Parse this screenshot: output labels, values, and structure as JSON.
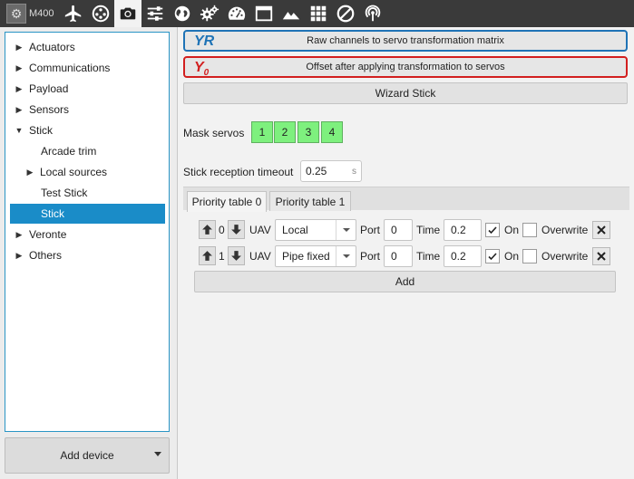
{
  "toolbar": {
    "device_label": "M400",
    "icons": [
      "airplane-icon",
      "joystick-icon",
      "camera-icon",
      "sliders-icon",
      "globe-icon",
      "gears-icon",
      "dashboard-icon",
      "window-icon",
      "mountains-icon",
      "grid-icon",
      "no-sign-icon",
      "antenna-icon"
    ],
    "active_icon": "camera-icon"
  },
  "sidebar": {
    "items": [
      {
        "label": "Actuators",
        "arrow": "▶"
      },
      {
        "label": "Communications",
        "arrow": "▶"
      },
      {
        "label": "Payload",
        "arrow": "▶"
      },
      {
        "label": "Sensors",
        "arrow": "▶"
      },
      {
        "label": "Stick",
        "arrow": "▼"
      },
      {
        "label": "Arcade trim",
        "arrow": ""
      },
      {
        "label": "Local sources",
        "arrow": "▶"
      },
      {
        "label": "Test Stick",
        "arrow": ""
      },
      {
        "label": "Stick",
        "arrow": "",
        "selected": true
      },
      {
        "label": "Veronte",
        "arrow": "▶"
      },
      {
        "label": "Others",
        "arrow": "▶"
      }
    ],
    "add_device_label": "Add device"
  },
  "main": {
    "yr_symbol": "YR",
    "yr_label": "Raw channels to servo transformation matrix",
    "y0_symbol": "Y",
    "y0_sub": "0",
    "y0_label": "Offset after applying transformation to servos",
    "wizard_label": "Wizard Stick",
    "mask_label": "Mask servos",
    "mask_servos": [
      "1",
      "2",
      "3",
      "4"
    ],
    "timeout_label": "Stick reception timeout",
    "timeout_value": "0.25",
    "timeout_unit": "s",
    "tabs": [
      "Priority table 0",
      "Priority table 1"
    ],
    "rows": [
      {
        "index": "0",
        "uav_label": "UAV",
        "uav": "Local",
        "port_label": "Port",
        "port": "0",
        "time_label": "Time",
        "time": "0.2",
        "on_label": "On",
        "on": true,
        "overwrite_label": "Overwrite",
        "overwrite": false
      },
      {
        "index": "1",
        "uav_label": "UAV",
        "uav": "Pipe fixed",
        "port_label": "Port",
        "port": "0",
        "time_label": "Time",
        "time": "0.2",
        "on_label": "On",
        "on": true,
        "overwrite_label": "Overwrite",
        "overwrite": false
      }
    ],
    "add_label": "Add"
  },
  "colors": {
    "toolbar_bg": "#3a3a3a",
    "selection": "#1a8cc8",
    "yr_border": "#1f73b6",
    "y0_border": "#d21f1f",
    "mask_green": "#7ef07e"
  }
}
